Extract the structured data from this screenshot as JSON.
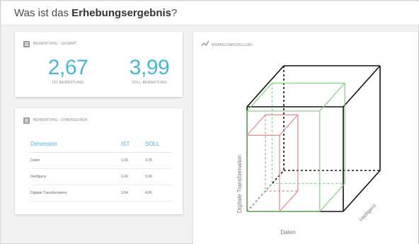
{
  "page": {
    "title_prefix": "Was ist das ",
    "title_bold": "Erhebungsergebnis",
    "title_suffix": "?"
  },
  "summary": {
    "label": "BEWERTUNG - GESAMT",
    "ist_value": "2,67",
    "ist_caption": "IST-BEWERTUNG",
    "soll_value": "3,99",
    "soll_caption": "SOLL-BEWERTUNG"
  },
  "dimensions": {
    "label": "BEWERTUNG - DIMENSIONEN",
    "headers": {
      "dimension": "Dimension",
      "ist": "IST",
      "soll": "SOLL"
    },
    "rows": [
      {
        "dimension": "Daten",
        "ist": "1,69",
        "soll": "3,78"
      },
      {
        "dimension": "Intelligenz",
        "ist": "2,49",
        "soll": "3,40"
      },
      {
        "dimension": "Digitale Transformation",
        "ist": "3,64",
        "soll": "4,80"
      }
    ]
  },
  "cube": {
    "label": "WÜRFELDARSTELLUNG",
    "axis_x": "Daten",
    "axis_y": "Digitale Transformation",
    "axis_z": "Intelligenz",
    "max": 5,
    "ist": {
      "x": 1.69,
      "y": 3.64,
      "z": 2.49
    },
    "soll": {
      "x": 3.78,
      "y": 4.8,
      "z": 3.4
    },
    "colors": {
      "frame": "#111111",
      "ist": "#d98a8a",
      "soll": "#7fcf7f",
      "accent": "#48b6d4"
    }
  }
}
